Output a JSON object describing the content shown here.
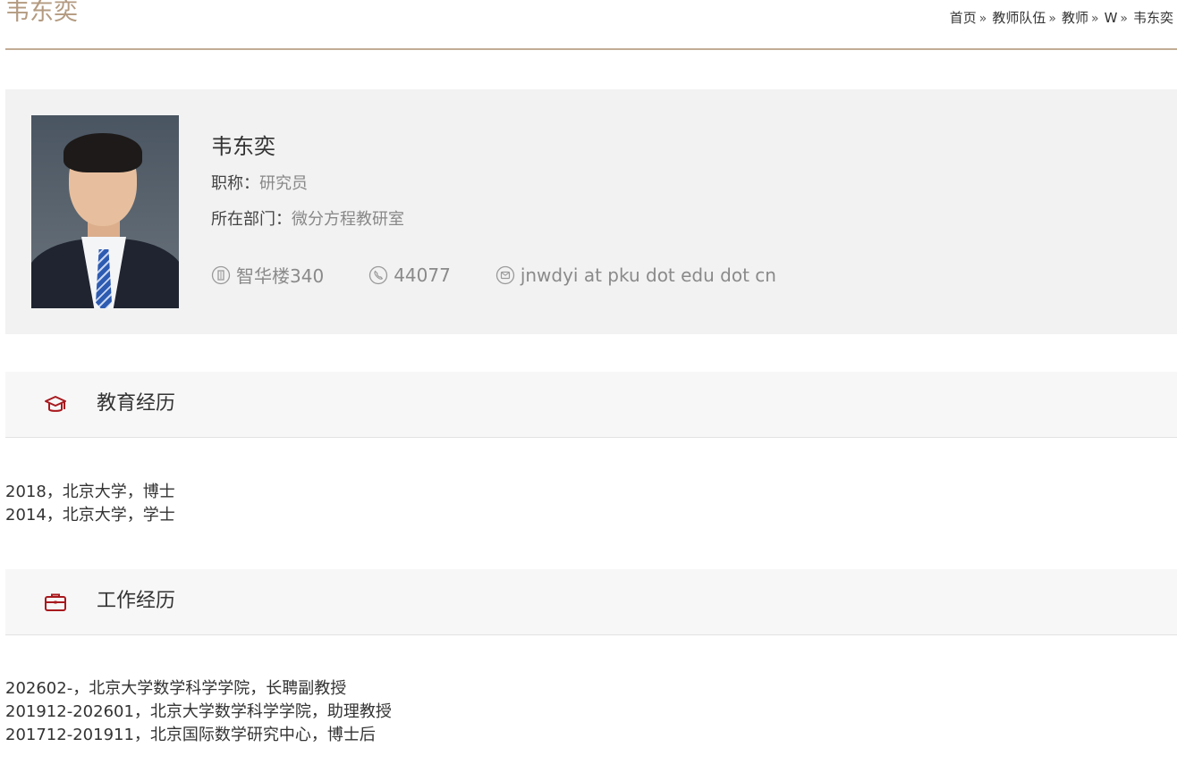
{
  "header": {
    "title": "韦东奕",
    "breadcrumb": [
      {
        "label": "首页"
      },
      {
        "label": "教师队伍"
      },
      {
        "label": "教师"
      },
      {
        "label": "W"
      },
      {
        "label": "韦东奕"
      }
    ],
    "breadcrumb_separator": "»"
  },
  "profile": {
    "name": "韦东奕",
    "title_label": "职称：",
    "title_value": "研究员",
    "dept_label": "所在部门：",
    "dept_value": "微分方程教研室",
    "office": "智华楼340",
    "phone": "44077",
    "email": "jnwdyi at pku dot edu dot cn",
    "office_icon": "building-icon",
    "phone_icon": "phone-icon",
    "email_icon": "email-icon"
  },
  "sections": [
    {
      "title": "教育经历",
      "icon": "graduation-cap-icon",
      "items": [
        "2018，北京大学，博士",
        "2014，北京大学，学士"
      ]
    },
    {
      "title": "工作经历",
      "icon": "briefcase-icon",
      "items": [
        "202602-，北京大学数学科学学院，长聘副教授",
        "201912-202601，北京大学数学科学学院，助理教授",
        "201712-201911，北京国际数学研究中心，博士后"
      ]
    }
  ],
  "colors": {
    "accent_brown": "#b39a80",
    "rule": "#c2ac95",
    "icon_red": "#a8191e",
    "panel_bg": "#f2f2f2"
  }
}
